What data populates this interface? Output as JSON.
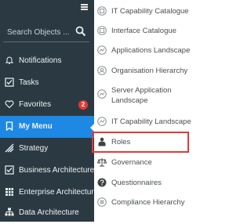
{
  "search": {
    "placeholder": "Search Objects ..."
  },
  "menu": {
    "items": [
      {
        "label": "Notifications"
      },
      {
        "label": "Tasks"
      },
      {
        "label": "Favorites",
        "badge": "2"
      },
      {
        "label": "My Menu"
      },
      {
        "label": "Strategy"
      },
      {
        "label": "Business Architecture"
      },
      {
        "label": "Enterprise Architecture"
      },
      {
        "label": "Data Architecture"
      }
    ]
  },
  "submenu": {
    "items": [
      {
        "label": "IT Capability Catalogue"
      },
      {
        "label": "Interface Catalogue"
      },
      {
        "label": "Applications Landscape"
      },
      {
        "label": "Organisation Hierarchy"
      },
      {
        "label": "Server Application Landscape"
      },
      {
        "label": "IT Capability Landscape"
      },
      {
        "label": "Roles"
      },
      {
        "label": "Governance"
      },
      {
        "label": "Questionnaires"
      },
      {
        "label": "Compliance Hierarchy"
      }
    ]
  },
  "colors": {
    "sidebar_bg": "#2b3a42",
    "active_bg": "#1e88e5",
    "badge_bg": "#e53935",
    "highlight_border": "#e53935"
  }
}
